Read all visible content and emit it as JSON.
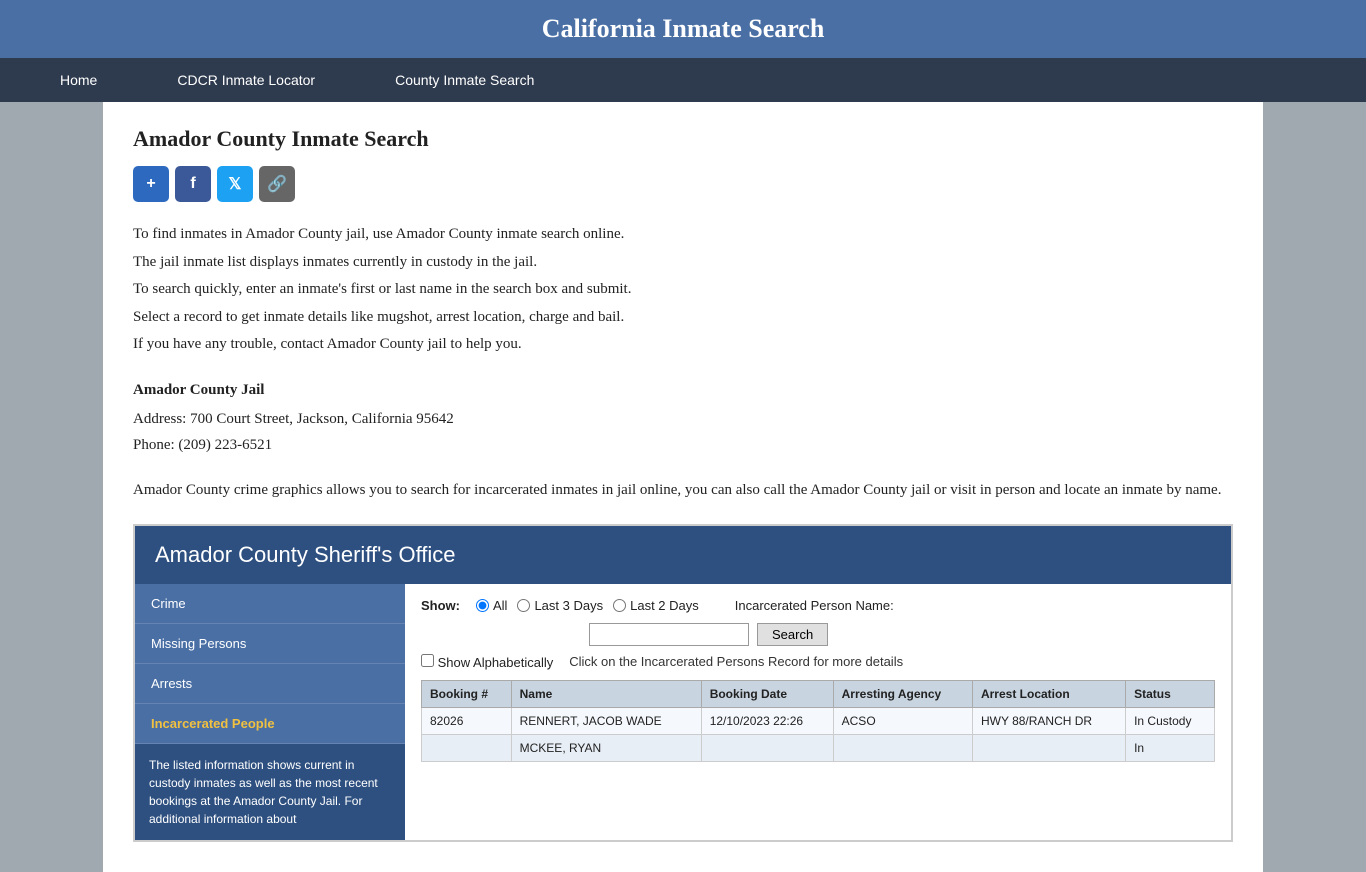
{
  "header": {
    "title": "California Inmate Search"
  },
  "nav": {
    "items": [
      {
        "label": "Home",
        "id": "home"
      },
      {
        "label": "CDCR Inmate Locator",
        "id": "cdcr"
      },
      {
        "label": "County Inmate Search",
        "id": "county"
      }
    ]
  },
  "page": {
    "heading": "Amador County Inmate Search",
    "share_buttons": [
      {
        "label": "+",
        "type": "share",
        "title": "Share"
      },
      {
        "label": "f",
        "type": "facebook",
        "title": "Facebook"
      },
      {
        "label": "🐦",
        "type": "twitter",
        "title": "Twitter"
      },
      {
        "label": "🔗",
        "type": "link",
        "title": "Copy Link"
      }
    ],
    "info_paragraphs": [
      "To find inmates in Amador County jail, use Amador County inmate search online.",
      "The jail inmate list displays inmates currently in custody in the jail.",
      "To search quickly, enter an inmate's first or last name in the search box and submit.",
      "Select a record to get inmate details like mugshot, arrest location, charge and bail.",
      "If you have any trouble, contact Amador County jail to help you."
    ],
    "jail": {
      "name": "Amador County Jail",
      "address": "Address: 700 Court Street, Jackson, California 95642",
      "phone": "Phone: (209) 223-6521"
    },
    "description": "Amador County crime graphics allows you to search for incarcerated inmates in jail online, you can also call the Amador County jail or visit in person and locate an inmate by name."
  },
  "sheriff_widget": {
    "title": "Amador County Sheriff's Office",
    "sidebar_items": [
      {
        "label": "Crime",
        "id": "crime",
        "active": false
      },
      {
        "label": "Missing Persons",
        "id": "missing",
        "active": false
      },
      {
        "label": "Arrests",
        "id": "arrests",
        "active": false
      },
      {
        "label": "Incarcerated People",
        "id": "incarcerated",
        "active": true
      }
    ],
    "sidebar_info": "The listed information shows current in custody inmates as well as the most recent bookings at the Amador County Jail. For additional information about",
    "search": {
      "show_label": "Show:",
      "radio_options": [
        {
          "label": "All",
          "value": "all",
          "checked": true
        },
        {
          "label": "Last 3 Days",
          "value": "3days",
          "checked": false
        },
        {
          "label": "Last 2 Days",
          "value": "2days",
          "checked": false
        }
      ],
      "name_label": "Incarcerated Person Name:",
      "search_placeholder": "",
      "search_button": "Search",
      "alphabetically_label": "Show Alphabetically",
      "click_instruction": "Click on the Incarcerated Persons Record for more details"
    },
    "table": {
      "columns": [
        "Booking #",
        "Name",
        "Booking Date",
        "Arresting Agency",
        "Arrest Location",
        "Status"
      ],
      "rows": [
        {
          "booking": "82026",
          "name": "RENNERT, JACOB WADE",
          "date": "12/10/2023 22:26",
          "agency": "ACSO",
          "location": "HWY 88/RANCH DR",
          "status": "In Custody"
        },
        {
          "booking": "",
          "name": "MCKEE, RYAN",
          "date": "",
          "agency": "",
          "location": "",
          "status": "In"
        }
      ]
    }
  }
}
